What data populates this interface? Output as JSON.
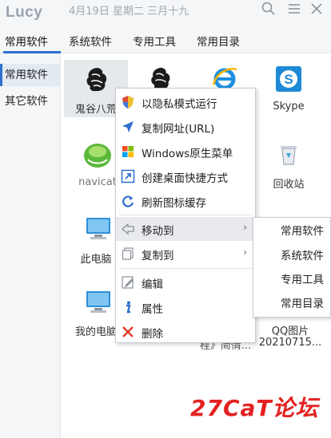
{
  "app": {
    "title": "Lucy",
    "date": "4月19日 星期二 三月十九"
  },
  "tabs": [
    "常用软件",
    "系统软件",
    "专用工具",
    "常用目录"
  ],
  "sidebar": [
    "常用软件",
    "其它软件"
  ],
  "apps": [
    {
      "label": "鬼谷八荒",
      "icon": "dragon-icon"
    },
    {
      "label": "",
      "icon": "dragon-icon"
    },
    {
      "label": "",
      "icon": "ie-icon"
    },
    {
      "label": "Skype",
      "icon": "skype-icon"
    },
    {
      "label": "navicat",
      "icon": "navicat-icon"
    },
    {
      "label": "回收站",
      "icon": "recycle-bin-icon"
    },
    {
      "label": "此电脑",
      "icon": "computer-icon"
    },
    {
      "label": "我的电脑",
      "icon": "computer-icon"
    },
    {
      "label": "QQ图片",
      "icon": "image-icon"
    },
    {
      "label": "20210715...",
      "icon": "image-icon"
    },
    {
      "label": "程》简情...",
      "icon": "document-icon"
    }
  ],
  "context_menu": {
    "items": [
      {
        "label": "以隐私模式运行",
        "icon": "shield-icon"
      },
      {
        "label": "复制网址(URL)",
        "icon": "navigate-icon"
      },
      {
        "label": "Windows原生菜单",
        "icon": "windows-icon"
      },
      {
        "label": "创建桌面快捷方式",
        "icon": "shortcut-icon"
      },
      {
        "label": "刷新图标缓存",
        "icon": "refresh-icon"
      },
      {
        "label": "移动到",
        "icon": "move-icon",
        "submenu": true
      },
      {
        "label": "复制到",
        "icon": "copy-icon",
        "submenu": true
      },
      {
        "label": "编辑",
        "icon": "edit-icon"
      },
      {
        "label": "属性",
        "icon": "info-icon"
      },
      {
        "label": "删除",
        "icon": "delete-icon"
      }
    ],
    "arrow": "›"
  },
  "submenu": [
    "常用软件",
    "系统软件",
    "专用工具",
    "常用目录"
  ],
  "watermark": "27CaT论坛",
  "colors": {
    "accent": "#2f6fcf",
    "watermark": "#e32121",
    "chrome": "#f4f6f8"
  }
}
